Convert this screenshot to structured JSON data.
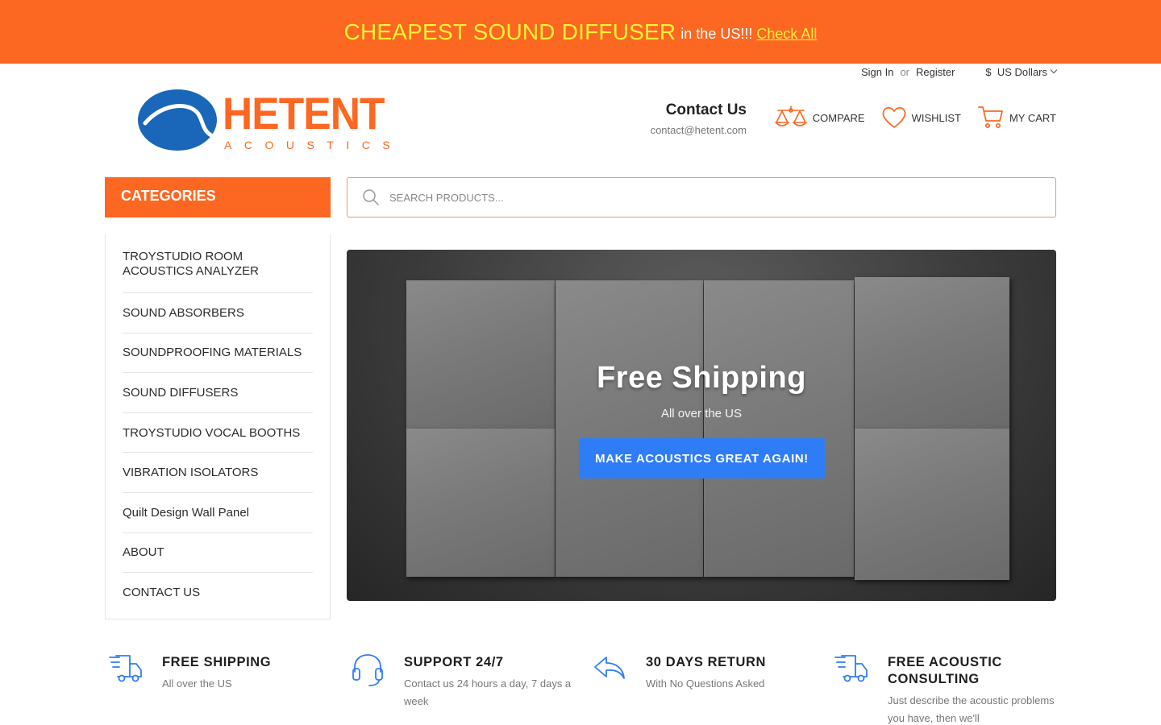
{
  "promo": {
    "headline": "CHEAPEST SOUND DIFFUSER",
    "suffix": "in the US!!!",
    "link": "Check All"
  },
  "account": {
    "sign_in": "Sign In",
    "or": "or",
    "register": "Register",
    "currency": "$  US Dollars"
  },
  "logo": {
    "name": "HETENT",
    "tagline": "ACOUSTICS"
  },
  "contact": {
    "title": "Contact Us",
    "email": "contact@hetent.com"
  },
  "tools": {
    "compare": "COMPARE",
    "wishlist": "WISHLIST",
    "cart": "MY CART"
  },
  "categories": {
    "header": "CATEGORIES",
    "items": [
      "TROYSTUDIO ROOM ACOUSTICS ANALYZER",
      "SOUND ABSORBERS",
      "SOUNDPROOFING MATERIALS",
      "SOUND DIFFUSERS",
      "TROYSTUDIO VOCAL BOOTHS",
      "VIBRATION ISOLATORS",
      "Quilt Design Wall Panel",
      "ABOUT",
      "CONTACT US"
    ]
  },
  "search": {
    "placeholder": "SEARCH PRODUCTS..."
  },
  "hero": {
    "title": "Free Shipping",
    "subtitle": "All over the US",
    "button": "MAKE ACOUSTICS GREAT AGAIN!"
  },
  "features": [
    {
      "title": "FREE SHIPPING",
      "desc": "All over the US",
      "icon": "delivery-truck-icon"
    },
    {
      "title": "SUPPORT 24/7",
      "desc": "Contact us 24 hours a day, 7 days a week",
      "icon": "headset-icon"
    },
    {
      "title": "30 DAYS RETURN",
      "desc": "With No Questions Asked",
      "icon": "return-arrow-icon"
    },
    {
      "title": "FREE ACOUSTIC CONSULTING",
      "desc": "Just describe the acoustic problems you have, then we'll",
      "icon": "delivery-truck-icon"
    }
  ],
  "colors": {
    "brand_orange": "#fc6721",
    "promo_yellow": "#fff23a",
    "button_blue": "#2f7df6",
    "logo_blue": "#1a66b8"
  }
}
